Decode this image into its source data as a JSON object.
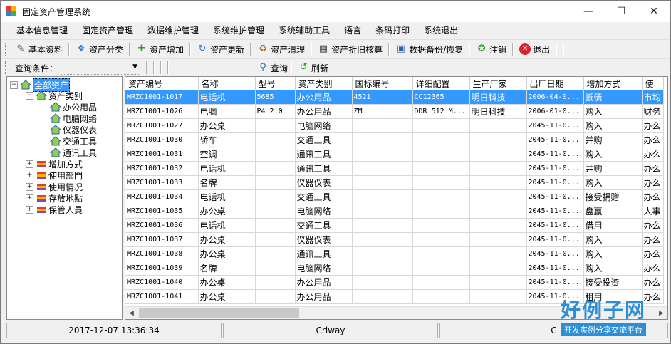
{
  "window": {
    "title": "固定资产管理系统"
  },
  "menu": [
    "基本信息管理",
    "固定资产管理",
    "数据维护管理",
    "系统维护管理",
    "系统辅助工具",
    "语言",
    "条码打印",
    "系统退出"
  ],
  "toolbar": [
    {
      "label": "基本资料",
      "icon": "pencil-icon"
    },
    {
      "label": "资产分类",
      "icon": "category-icon"
    },
    {
      "label": "资产增加",
      "icon": "add-icon"
    },
    {
      "label": "资产更新",
      "icon": "update-icon"
    },
    {
      "label": "资产清理",
      "icon": "clean-icon"
    },
    {
      "label": "资产折旧核算",
      "icon": "calculator-icon"
    },
    {
      "label": "数据备份/恢复",
      "icon": "backup-icon"
    },
    {
      "label": "注销",
      "icon": "logout-person-icon"
    },
    {
      "label": "退出",
      "icon": "exit-icon"
    }
  ],
  "query": {
    "label": "查询条件：",
    "search_label": "查询",
    "refresh_label": "刷新"
  },
  "tree": {
    "root": "全部资产",
    "category": "资产类别",
    "category_children": [
      "办公用品",
      "电脑网络",
      "仪器仪表",
      "交通工具",
      "通讯工具"
    ],
    "others": [
      "增加方式",
      "使用部門",
      "使用情况",
      "存放地點",
      "保管人員"
    ]
  },
  "table": {
    "columns": [
      "资产编号",
      "名称",
      "型号",
      "资产类别",
      "国标编号",
      "详细配置",
      "生产厂家",
      "出厂日期",
      "增加方式",
      "使"
    ],
    "rows": [
      [
        "MRZC1001-1017",
        "电话机",
        "5685",
        "办公用品",
        "4521",
        "CC12365",
        "明日科技",
        "2006-04-0...",
        "抵债",
        "市均"
      ],
      [
        "MRZC1001-1026",
        "电脑",
        "P4 2.0",
        "办公用品",
        "ZM",
        "DDR 512 M...",
        "明日科技",
        "2006-01-0...",
        "购入",
        "财务"
      ],
      [
        "MRZC1001-1027",
        "办公桌",
        "",
        "电脑网络",
        "",
        "",
        "",
        "2045-11-0...",
        "购入",
        "办么"
      ],
      [
        "MRZC1001-1030",
        "轿车",
        "",
        "交通工具",
        "",
        "",
        "",
        "2045-11-0...",
        "并购",
        "办么"
      ],
      [
        "MRZC1001-1031",
        "空调",
        "",
        "通讯工具",
        "",
        "",
        "",
        "2045-11-0...",
        "购入",
        "办么"
      ],
      [
        "MRZC1001-1032",
        "电话机",
        "",
        "通讯工具",
        "",
        "",
        "",
        "2045-11-0...",
        "并购",
        "办么"
      ],
      [
        "MRZC1001-1033",
        "名牌",
        "",
        "仪器仪表",
        "",
        "",
        "",
        "2045-11-0...",
        "购入",
        "办么"
      ],
      [
        "MRZC1001-1034",
        "电话机",
        "",
        "交通工具",
        "",
        "",
        "",
        "2045-11-0...",
        "接受捐赠",
        "办么"
      ],
      [
        "MRZC1001-1035",
        "办公桌",
        "",
        "电脑网络",
        "",
        "",
        "",
        "2045-11-0...",
        "盘赢",
        "人事"
      ],
      [
        "MRZC1001-1036",
        "电话机",
        "",
        "交通工具",
        "",
        "",
        "",
        "2045-11-0...",
        "借用",
        "办么"
      ],
      [
        "MRZC1001-1037",
        "办公桌",
        "",
        "仪器仪表",
        "",
        "",
        "",
        "2045-11-0...",
        "购入",
        "办么"
      ],
      [
        "MRZC1001-1038",
        "办公桌",
        "",
        "通讯工具",
        "",
        "",
        "",
        "2045-11-0...",
        "购入",
        "办么"
      ],
      [
        "MRZC1001-1039",
        "名牌",
        "",
        "电脑网络",
        "",
        "",
        "",
        "2045-11-0...",
        "购入",
        "办么"
      ],
      [
        "MRZC1001-1040",
        "办公桌",
        "",
        "办公用品",
        "",
        "",
        "",
        "2045-11-0...",
        "接受投资",
        "办么"
      ],
      [
        "MRZC1001-1041",
        "办公桌",
        "",
        "办公用品",
        "",
        "",
        "",
        "2045-11-0...",
        "租用",
        "办么"
      ]
    ]
  },
  "status": [
    "2017-12-07 13:36:34",
    "Criway",
    "C"
  ],
  "watermark": {
    "big": "好例子网",
    "small": "开发实例分享交流平台"
  }
}
